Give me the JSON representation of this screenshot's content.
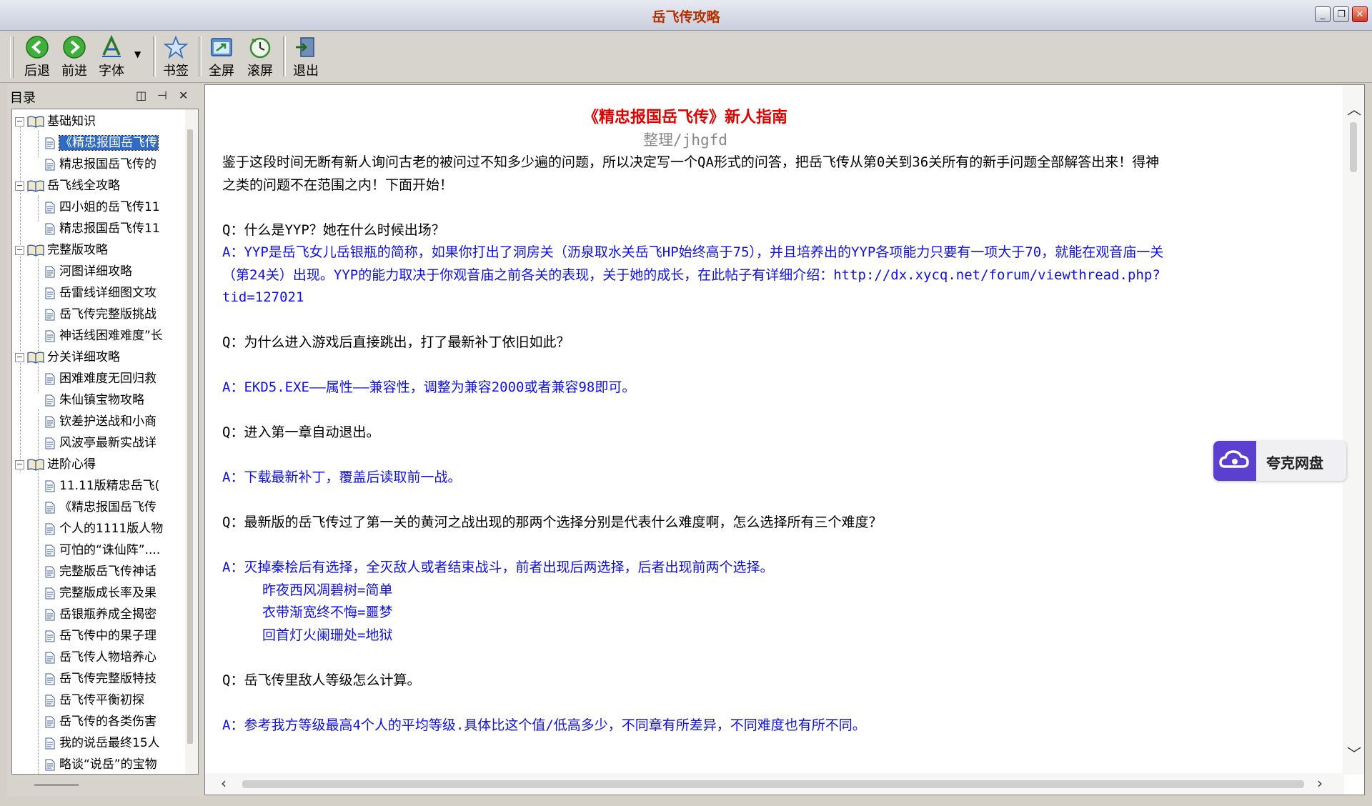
{
  "window": {
    "title": "岳飞传攻略"
  },
  "toolbar": {
    "back": "后退",
    "forward": "前进",
    "font": "字体",
    "bookmark": "书签",
    "fullscreen": "全屏",
    "autoscroll": "滚屏",
    "exit": "退出"
  },
  "sidebar": {
    "title": "目录",
    "nodes": [
      {
        "label": "基础知识"
      },
      {
        "label": "《精忠报国岳飞传"
      },
      {
        "label": "精忠报国岳飞传的"
      },
      {
        "label": "岳飞线全攻略"
      },
      {
        "label": "四小姐的岳飞传11"
      },
      {
        "label": "精忠报国岳飞传11"
      },
      {
        "label": "完整版攻略"
      },
      {
        "label": "河图详细攻略"
      },
      {
        "label": "岳雷线详细图文攻"
      },
      {
        "label": "岳飞传完整版挑战"
      },
      {
        "label": "神话线困难难度”长"
      },
      {
        "label": "分关详细攻略"
      },
      {
        "label": "困难难度无回归救"
      },
      {
        "label": "朱仙镇宝物攻略"
      },
      {
        "label": "钦差护送战和小商"
      },
      {
        "label": "风波亭最新实战详"
      },
      {
        "label": "进阶心得"
      },
      {
        "label": "11.11版精忠岳飞("
      },
      {
        "label": "《精忠报国岳飞传"
      },
      {
        "label": "个人的1111版人物"
      },
      {
        "label": "可怕的“诛仙阵”...."
      },
      {
        "label": "完整版岳飞传神话"
      },
      {
        "label": "完整版成长率及果"
      },
      {
        "label": "岳银瓶养成全揭密"
      },
      {
        "label": "岳飞传中的果子理"
      },
      {
        "label": "岳飞传人物培养心"
      },
      {
        "label": "岳飞传完整版特技"
      },
      {
        "label": "岳飞传平衡初探"
      },
      {
        "label": "岳飞传的各类伤害"
      },
      {
        "label": "我的说岳最终15人"
      },
      {
        "label": "略谈“说岳”的宝物"
      }
    ]
  },
  "doc": {
    "title": "《精忠报国岳飞传》新人指南",
    "subtitle": "整理/jhgfd",
    "intro1": "鉴于这段时间无断有新人询问古老的被问过不知多少遍的问题，所以决定写一个QA形式的问答，把岳飞传从第0关到36关所有的新手问题全部解答出来！得神",
    "intro2": "之类的问题不在范围之内！下面开始！",
    "q1": "Q：什么是YYP？她在什么时候出场？",
    "a1_1": "A：YYP是岳飞女儿岳银瓶的简称，如果你打出了洞房关（沥泉取水关岳飞HP始终高于75），并且培养出的YYP各项能力只要有一项大于70，就能在观音庙一关",
    "a1_2": "（第24关）出现。YYP的能力取决于你观音庙之前各关的表现，关于她的成长，在此帖子有详细介绍：http://dx.xycq.net/forum/viewthread.php?",
    "a1_3": "tid=127021",
    "q2": "Q：为什么进入游戏后直接跳出，打了最新补丁依旧如此？",
    "a2": "A：EKD5.EXE——属性——兼容性，调整为兼容2000或者兼容98即可。",
    "q3": "Q：进入第一章自动退出。",
    "a3": "A：下载最新补丁，覆盖后读取前一战。",
    "q4": "Q：最新版的岳飞传过了第一关的黄河之战出现的那两个选择分别是代表什么难度啊，怎么选择所有三个难度？",
    "a4": "A：灭掉秦桧后有选择，全灭敌人或者结束战斗，前者出现后两选择，后者出现前两个选择。",
    "a4_1": "昨夜西风凋碧树=简单",
    "a4_2": "衣带渐宽终不悔=噩梦",
    "a4_3": "回首灯火阑珊处=地狱",
    "q5": "Q：岳飞传里敌人等级怎么计算。",
    "a5": "A：参考我方等级最高4个人的平均等级.具体比这个值/低高多少，不同章有所差异，不同难度也有所不同。"
  },
  "widget": {
    "label": "夸克网盘"
  }
}
